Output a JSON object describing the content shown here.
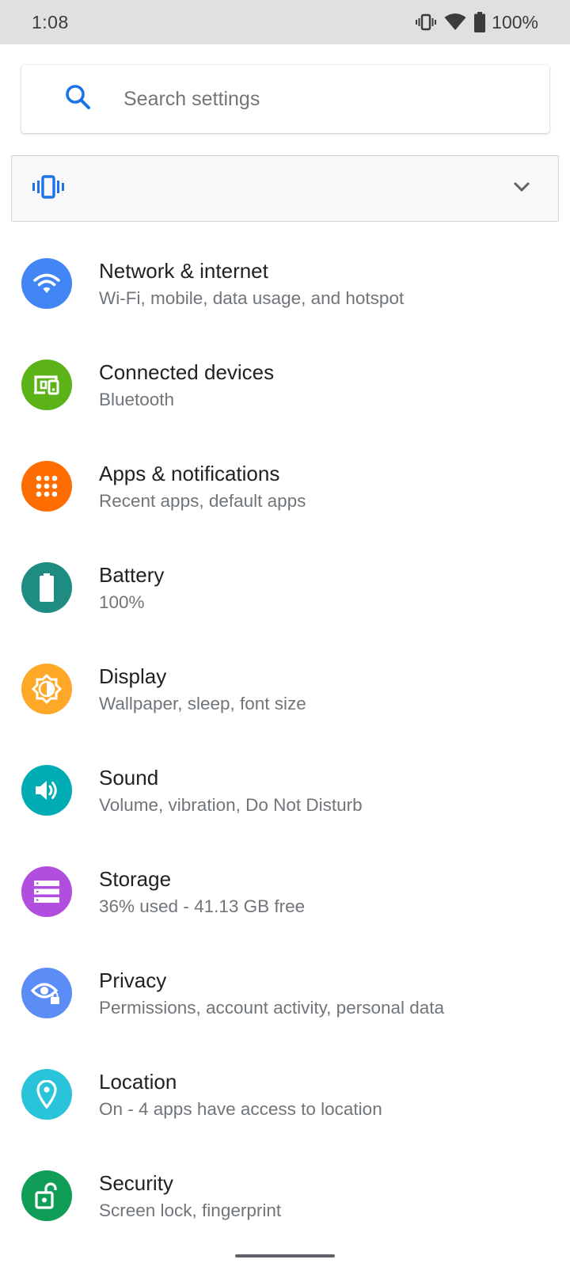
{
  "status_bar": {
    "time": "1:08",
    "battery_percent": "100%",
    "icons": [
      "vibrate-icon",
      "wifi-icon",
      "battery-icon"
    ]
  },
  "search": {
    "placeholder": "Search settings",
    "icon": "search-icon"
  },
  "condition": {
    "icon": "vibrate-icon",
    "expand_icon": "chevron-down-icon"
  },
  "colors": {
    "accent": "#1a73e8",
    "network": "#4285f4",
    "connected": "#5bb318",
    "apps": "#ff6d00",
    "battery": "#1e8c80",
    "display": "#ffa726",
    "sound": "#00acb3",
    "storage": "#b14ee0",
    "privacy": "#5c8df6",
    "location": "#29c4d9",
    "security": "#0f9d58"
  },
  "settings": [
    {
      "title": "Network & internet",
      "subtitle": "Wi-Fi, mobile, data usage, and hotspot",
      "icon": "wifi-icon"
    },
    {
      "title": "Connected devices",
      "subtitle": "Bluetooth",
      "icon": "devices-icon"
    },
    {
      "title": "Apps & notifications",
      "subtitle": "Recent apps, default apps",
      "icon": "apps-grid-icon"
    },
    {
      "title": "Battery",
      "subtitle": "100%",
      "icon": "battery-icon"
    },
    {
      "title": "Display",
      "subtitle": "Wallpaper, sleep, font size",
      "icon": "brightness-icon"
    },
    {
      "title": "Sound",
      "subtitle": "Volume, vibration, Do Not Disturb",
      "icon": "volume-icon"
    },
    {
      "title": "Storage",
      "subtitle": "36% used - 41.13 GB free",
      "icon": "storage-icon"
    },
    {
      "title": "Privacy",
      "subtitle": "Permissions, account activity, personal data",
      "icon": "privacy-eye-icon"
    },
    {
      "title": "Location",
      "subtitle": "On - 4 apps have access to location",
      "icon": "location-pin-icon"
    },
    {
      "title": "Security",
      "subtitle": "Screen lock, fingerprint",
      "icon": "unlock-icon"
    }
  ]
}
